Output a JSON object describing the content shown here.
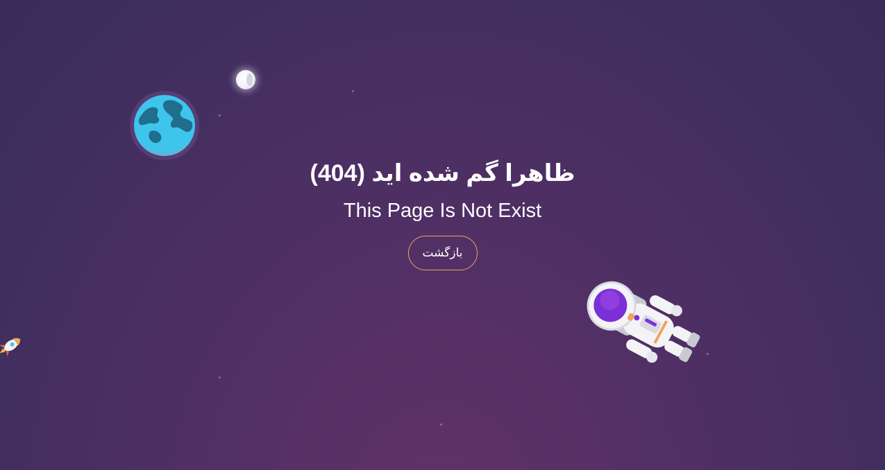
{
  "error": {
    "title_fa": "ظاهرا گم شده اید (404)",
    "title_en": "This Page Is Not Exist"
  },
  "actions": {
    "back_label": "بازگشت"
  },
  "theme": {
    "background": "#4e2f64",
    "button_border": "#f0a35e",
    "text": "#ffffff"
  },
  "illustrations": [
    "moon-icon",
    "earth-icon",
    "rocket-icon",
    "astronaut-icon"
  ]
}
